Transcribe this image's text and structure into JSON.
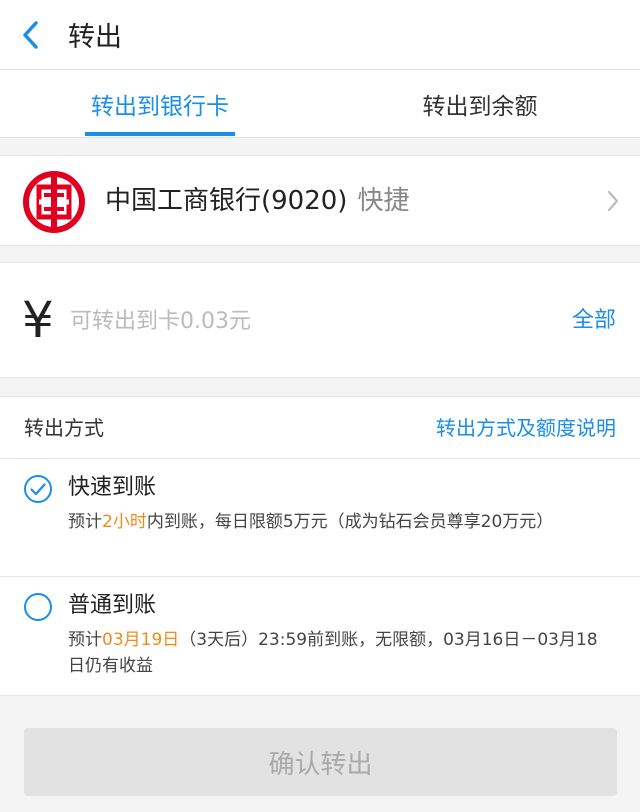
{
  "header": {
    "back_icon": "chevron-left-icon",
    "title": "转出"
  },
  "tabs": [
    {
      "label": "转出到银行卡",
      "active": true
    },
    {
      "label": "转出到余额",
      "active": false
    }
  ],
  "bank": {
    "logo_icon": "icbc-logo-icon",
    "name": "中国工商银行(9020)",
    "tag": "快捷",
    "chevron_icon": "chevron-right-icon"
  },
  "amount": {
    "currency_symbol": "¥",
    "value": "",
    "placeholder": "可转出到卡0.03元",
    "all_label": "全部"
  },
  "method": {
    "title": "转出方式",
    "help_link": "转出方式及额度说明",
    "options": [
      {
        "title": "快速到账",
        "selected": true,
        "desc_prefix": "预计",
        "desc_highlight": "2小时",
        "desc_suffix": "内到账，每日限额5万元（成为钻石会员尊享20万元）"
      },
      {
        "title": "普通到账",
        "selected": false,
        "desc_prefix": "预计",
        "desc_highlight": "03月19日",
        "desc_suffix": "（3天后）23:59前到账，无限额，03月16日－03月18日仍有收益"
      }
    ]
  },
  "confirm_button": "确认转出",
  "colors": {
    "accent": "#1a8ee8",
    "highlight": "#f28a1b",
    "bank_red": "#e1001f"
  }
}
